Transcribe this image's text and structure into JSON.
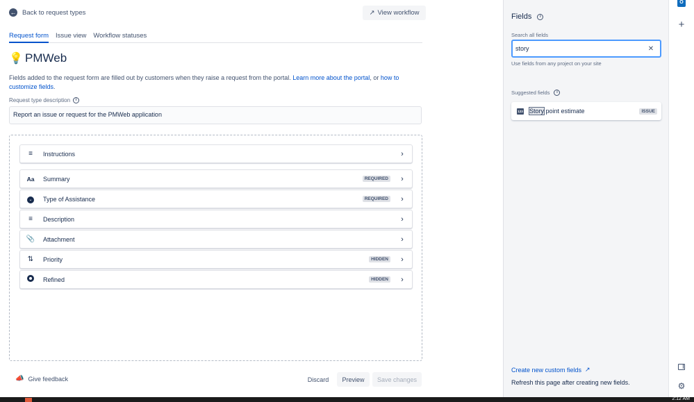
{
  "header": {
    "back_label": "Back to request types",
    "view_workflow_label": "View workflow"
  },
  "tabs": [
    {
      "label": "Request form",
      "active": true
    },
    {
      "label": "Issue view",
      "active": false
    },
    {
      "label": "Workflow statuses",
      "active": false
    }
  ],
  "request_type": {
    "name": "PMWeb",
    "info_text": "Fields added to the request form are filled out by customers when they raise a request from the portal.",
    "learn_more_link": "Learn more about the portal",
    "info_or": ", or",
    "customize_link": "how to customize fields",
    "description_label": "Request type description",
    "description_value": "Report an issue or request for the PMWeb application"
  },
  "form_fields": [
    {
      "label": "Instructions",
      "icon": "text-lines-icon",
      "badge": ""
    },
    {
      "label": "Summary",
      "icon": "text-format-icon",
      "badge": "REQUIRED"
    },
    {
      "label": "Type of Assistance",
      "icon": "dropdown-circle-icon",
      "badge": "REQUIRED"
    },
    {
      "label": "Description",
      "icon": "text-lines-icon",
      "badge": ""
    },
    {
      "label": "Attachment",
      "icon": "paperclip-icon",
      "badge": ""
    },
    {
      "label": "Priority",
      "icon": "priority-arrows-icon",
      "badge": "HIDDEN"
    },
    {
      "label": "Refined",
      "icon": "radio-circle-icon",
      "badge": "HIDDEN"
    }
  ],
  "footer": {
    "feedback_label": "Give feedback",
    "discard_label": "Discard",
    "preview_label": "Preview",
    "save_label": "Save changes"
  },
  "fields_panel": {
    "title": "Fields",
    "search_label": "Search all fields",
    "search_value": "story",
    "search_hint": "Use fields from any project on your site",
    "suggested_label": "Suggested fields",
    "suggested": [
      {
        "match": "Story",
        "rest": " point estimate",
        "badge": "ISSUE",
        "icon_text": "123"
      }
    ],
    "create_link": "Create new custom fields",
    "refresh_text": "Refresh this page after creating new fields."
  },
  "taskbar": {
    "clock": "2:12 AM"
  }
}
